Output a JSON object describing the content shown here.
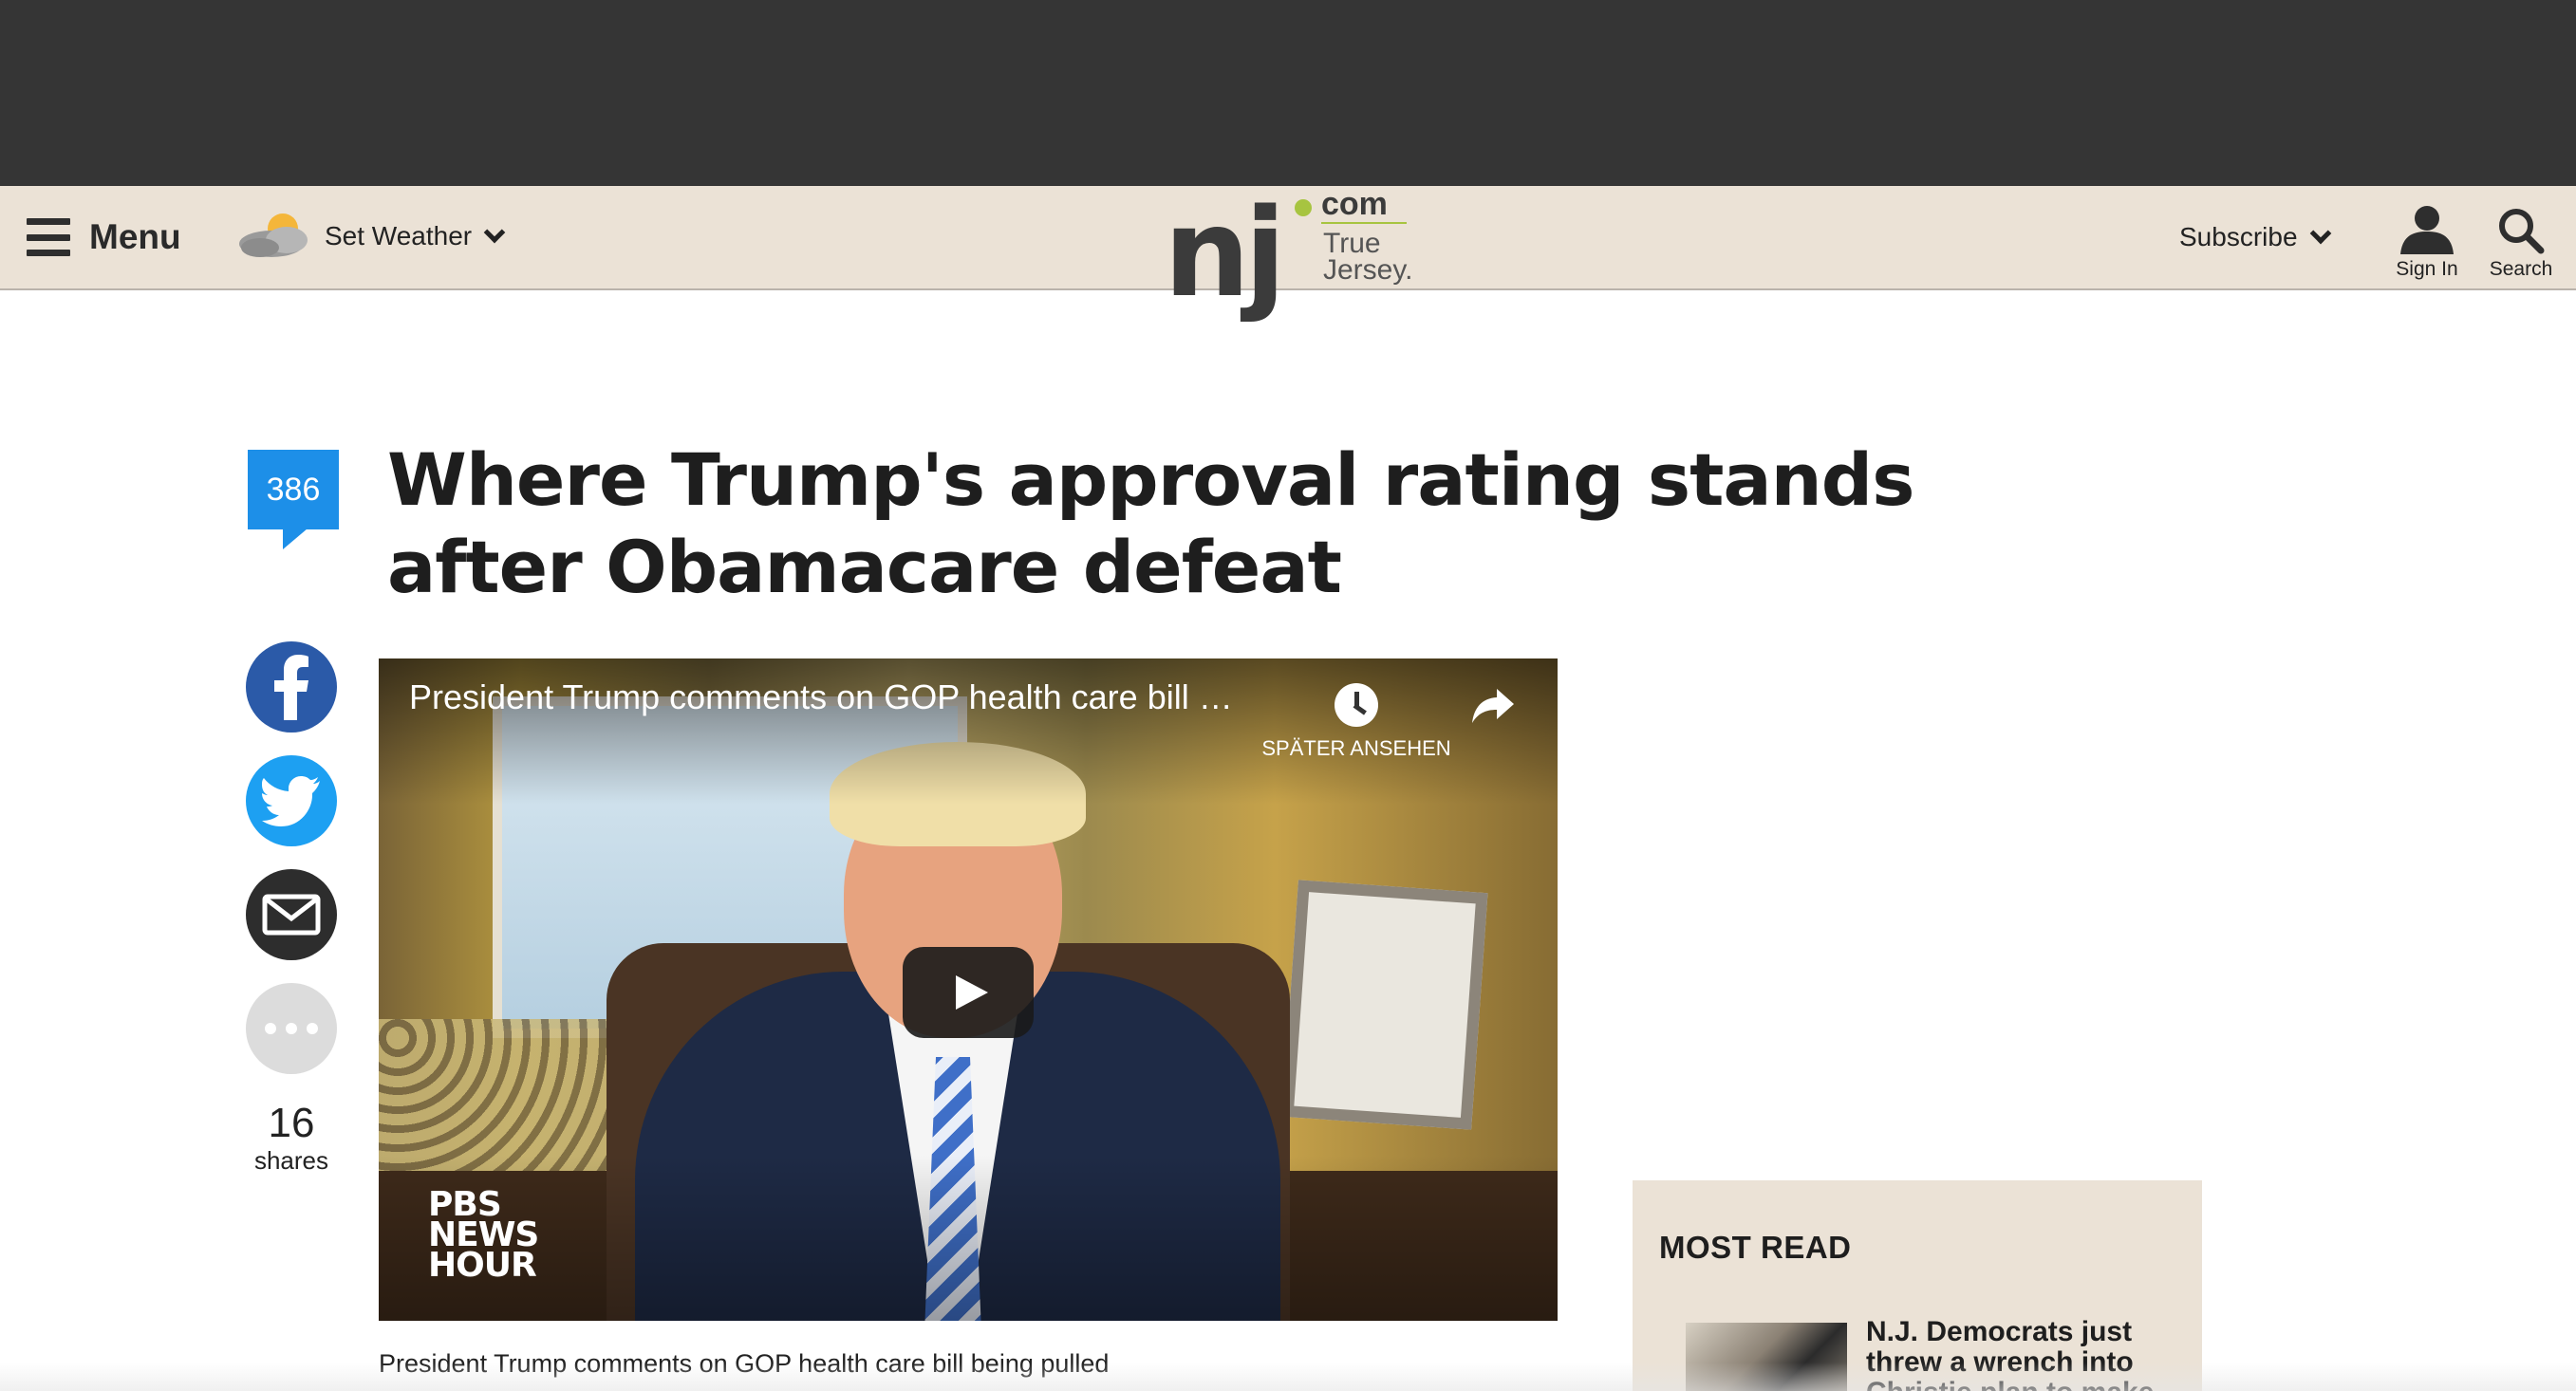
{
  "header": {
    "menu_label": "Menu",
    "weather_label": "Set Weather",
    "weather_icon": "partly-cloudy-icon",
    "logo": {
      "main": "nj",
      "com": "com",
      "tagline_line1": "True",
      "tagline_line2": "Jersey."
    },
    "subscribe_label": "Subscribe",
    "signin_label": "Sign In",
    "search_label": "Search",
    "background_color": "#ebe2d6"
  },
  "article": {
    "comment_count": "386",
    "headline": "Where Trump's approval rating stands after Obamacare defeat",
    "share_buttons": [
      "facebook-icon",
      "twitter-icon",
      "email-icon",
      "more-icon"
    ],
    "share_count": "16",
    "share_count_label": "shares",
    "video": {
      "title": "President Trump comments on GOP health care bill …",
      "watch_later_label": "SPÄTER ANSEHEN",
      "brand_line1": "PBS",
      "brand_line2": "NEWS",
      "brand_line3": "HOUR"
    },
    "caption": "President Trump comments on GOP health care bill being pulled"
  },
  "sidebar": {
    "most_read_title": "MOST READ",
    "most_read_items": [
      {
        "title": "N.J. Democrats just threw a wrench into Christie plan to make it"
      }
    ]
  },
  "colors": {
    "top_ad_bg": "#353535",
    "comment_blue": "#1d8fe8",
    "facebook": "#2b5aa8",
    "twitter": "#1da0f2",
    "logo_accent": "#a7c440"
  }
}
